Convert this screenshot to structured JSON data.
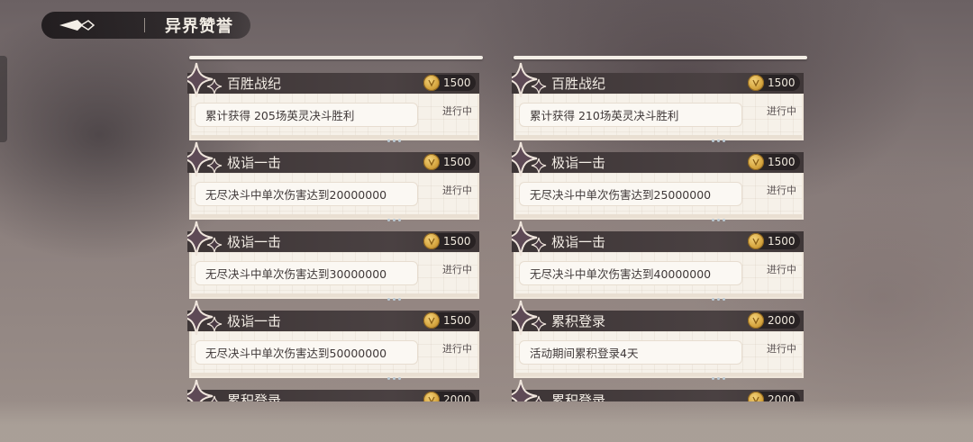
{
  "header": {
    "title": "异界赞誉"
  },
  "columns": [
    {
      "cards": [
        {
          "title": "百胜战纪",
          "reward": "1500",
          "desc": "累计获得 205场英灵决斗胜利",
          "status": "进行中"
        },
        {
          "title": "极诣一击",
          "reward": "1500",
          "desc": "无尽决斗中单次伤害达到20000000",
          "status": "进行中"
        },
        {
          "title": "极诣一击",
          "reward": "1500",
          "desc": "无尽决斗中单次伤害达到30000000",
          "status": "进行中"
        },
        {
          "title": "极诣一击",
          "reward": "1500",
          "desc": "无尽决斗中单次伤害达到50000000",
          "status": "进行中"
        },
        {
          "title": "累积登录",
          "reward": "2000",
          "desc": "",
          "status": ""
        }
      ]
    },
    {
      "cards": [
        {
          "title": "百胜战纪",
          "reward": "1500",
          "desc": "累计获得 210场英灵决斗胜利",
          "status": "进行中"
        },
        {
          "title": "极诣一击",
          "reward": "1500",
          "desc": "无尽决斗中单次伤害达到25000000",
          "status": "进行中"
        },
        {
          "title": "极诣一击",
          "reward": "1500",
          "desc": "无尽决斗中单次伤害达到40000000",
          "status": "进行中"
        },
        {
          "title": "累积登录",
          "reward": "2000",
          "desc": "活动期间累积登录4天",
          "status": "进行中"
        },
        {
          "title": "累积登录",
          "reward": "2000",
          "desc": "",
          "status": ""
        }
      ]
    }
  ],
  "icons": {
    "back": "back-arrow-icon",
    "coin": "coin-icon",
    "star": "sparkle-star-icon"
  },
  "colors": {
    "header_bg": "#1c181a",
    "card_head": "#3d3536",
    "card_body": "#f6f1e9",
    "coin": "#d6a640"
  }
}
